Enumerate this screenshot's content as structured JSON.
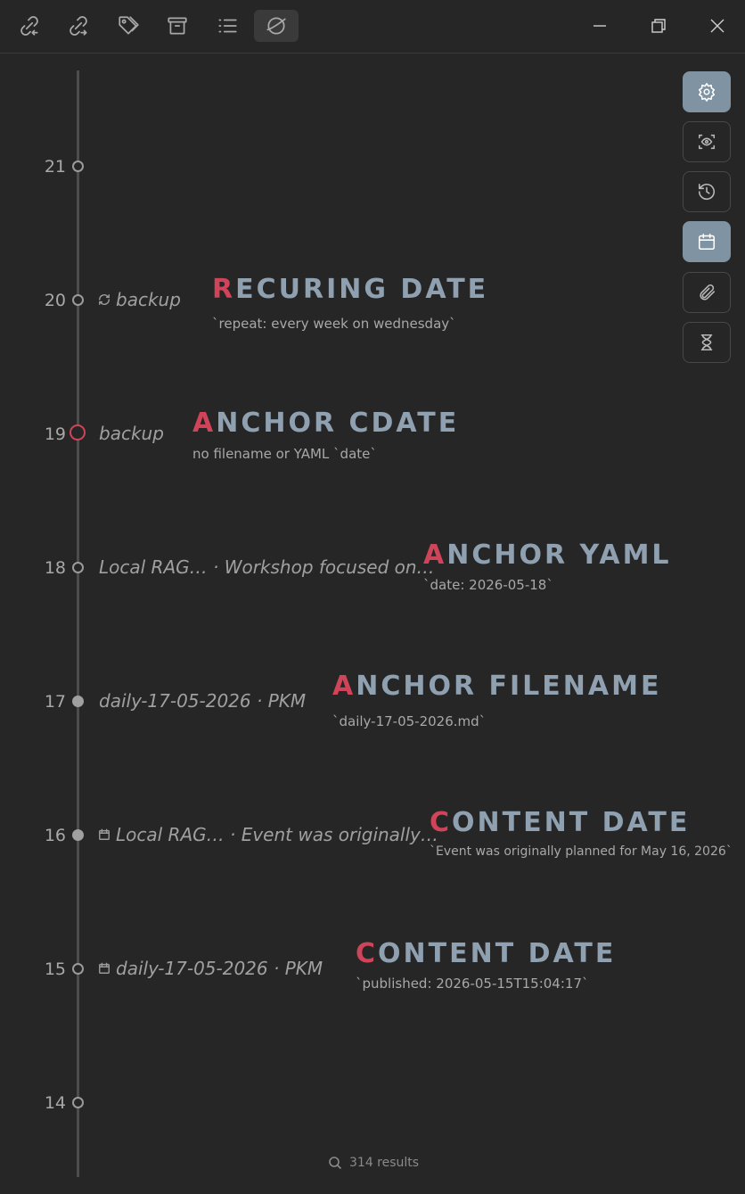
{
  "toolbar": {
    "buttons": [
      {
        "name": "backlinks-icon"
      },
      {
        "name": "outgoing-links-icon"
      },
      {
        "name": "tags-icon"
      },
      {
        "name": "archive-icon"
      },
      {
        "name": "outline-icon"
      },
      {
        "name": "timeline-icon",
        "active": true
      }
    ]
  },
  "window": {
    "minimize": "minimize-icon",
    "restore": "restore-icon",
    "close": "close-icon"
  },
  "timeline": {
    "rows": [
      {
        "day": "21"
      },
      {
        "day": "20",
        "note": "backup",
        "note_icon": "repeat-icon",
        "title_first": "R",
        "title_rest": "ECURING DATE",
        "subtitle": "`repeat: every week on wednesday`"
      },
      {
        "day": "19",
        "note": "backup",
        "title_first": "A",
        "title_rest": "NCHOR CDATE",
        "subtitle": "no filename or YAML `date`"
      },
      {
        "day": "18",
        "note": "Local RAG… · Workshop focused on…",
        "title_first": "A",
        "title_rest": "NCHOR YAML",
        "subtitle": "`date: 2026-05-18`"
      },
      {
        "day": "17",
        "note": "daily-17-05-2026 · PKM",
        "title_first": "A",
        "title_rest": "NCHOR FILENAME",
        "subtitle": "`daily-17-05-2026.md`"
      },
      {
        "day": "16",
        "note": "Local RAG… · Event was originally…",
        "note_icon": "calendar-icon",
        "title_first": "C",
        "title_rest": "ONTENT DATE",
        "subtitle": "`Event was originally planned for May 16, 2026`"
      },
      {
        "day": "15",
        "note": "daily-17-05-2026 · PKM",
        "note_icon": "calendar-icon",
        "title_first": "C",
        "title_rest": "ONTENT DATE",
        "subtitle": "`published: 2026-05-15T15:04:17`"
      },
      {
        "day": "14"
      }
    ]
  },
  "sidebar": {
    "buttons": [
      {
        "name": "settings-icon",
        "active": true
      },
      {
        "name": "eye-scan-icon"
      },
      {
        "name": "history-icon"
      },
      {
        "name": "calendar-icon",
        "active": true
      },
      {
        "name": "paperclip-icon"
      },
      {
        "name": "hourglass-icon"
      }
    ]
  },
  "footer": {
    "results": "314 results"
  },
  "colors": {
    "accent": "#d0445a",
    "title": "#8fa0b0",
    "active_button": "#7f93a3",
    "background": "#262626"
  }
}
